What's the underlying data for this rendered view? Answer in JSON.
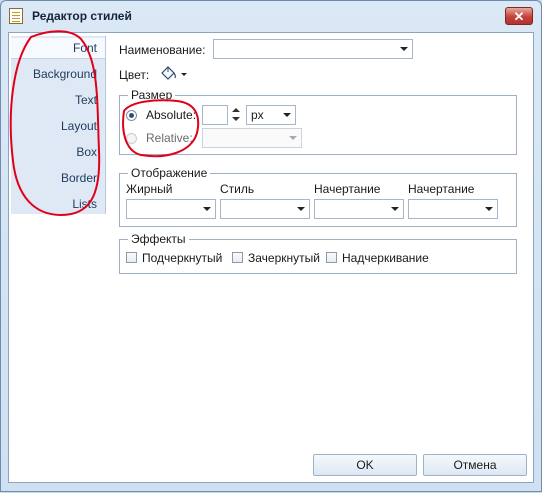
{
  "window": {
    "title": "Редактор стилей",
    "close_glyph": "✕"
  },
  "categories": [
    {
      "label": "Font",
      "selected": true
    },
    {
      "label": "Background"
    },
    {
      "label": "Text"
    },
    {
      "label": "Layout"
    },
    {
      "label": "Box"
    },
    {
      "label": "Border"
    },
    {
      "label": "Lists"
    }
  ],
  "fields": {
    "name_label": "Наименование:",
    "name_value": "",
    "color_label": "Цвет:",
    "color_icon": "paint-bucket-icon"
  },
  "size_group": {
    "legend": "Размер",
    "absolute_label": "Absolute:",
    "absolute_value": "",
    "unit_value": "px",
    "relative_label": "Relative:",
    "relative_value": ""
  },
  "display_group": {
    "legend": "Отображение",
    "columns": [
      "Жирный",
      "Стиль",
      "Начертание",
      "Начертание"
    ]
  },
  "effects_group": {
    "legend": "Эффекты",
    "checks": [
      "Подчеркнутый",
      "Зачеркнутый",
      "Надчеркивание"
    ]
  },
  "buttons": {
    "ok": "OK",
    "cancel": "Отмена"
  },
  "colors": {
    "annotation": "#e0001a",
    "accent": "#2c4f7c"
  }
}
